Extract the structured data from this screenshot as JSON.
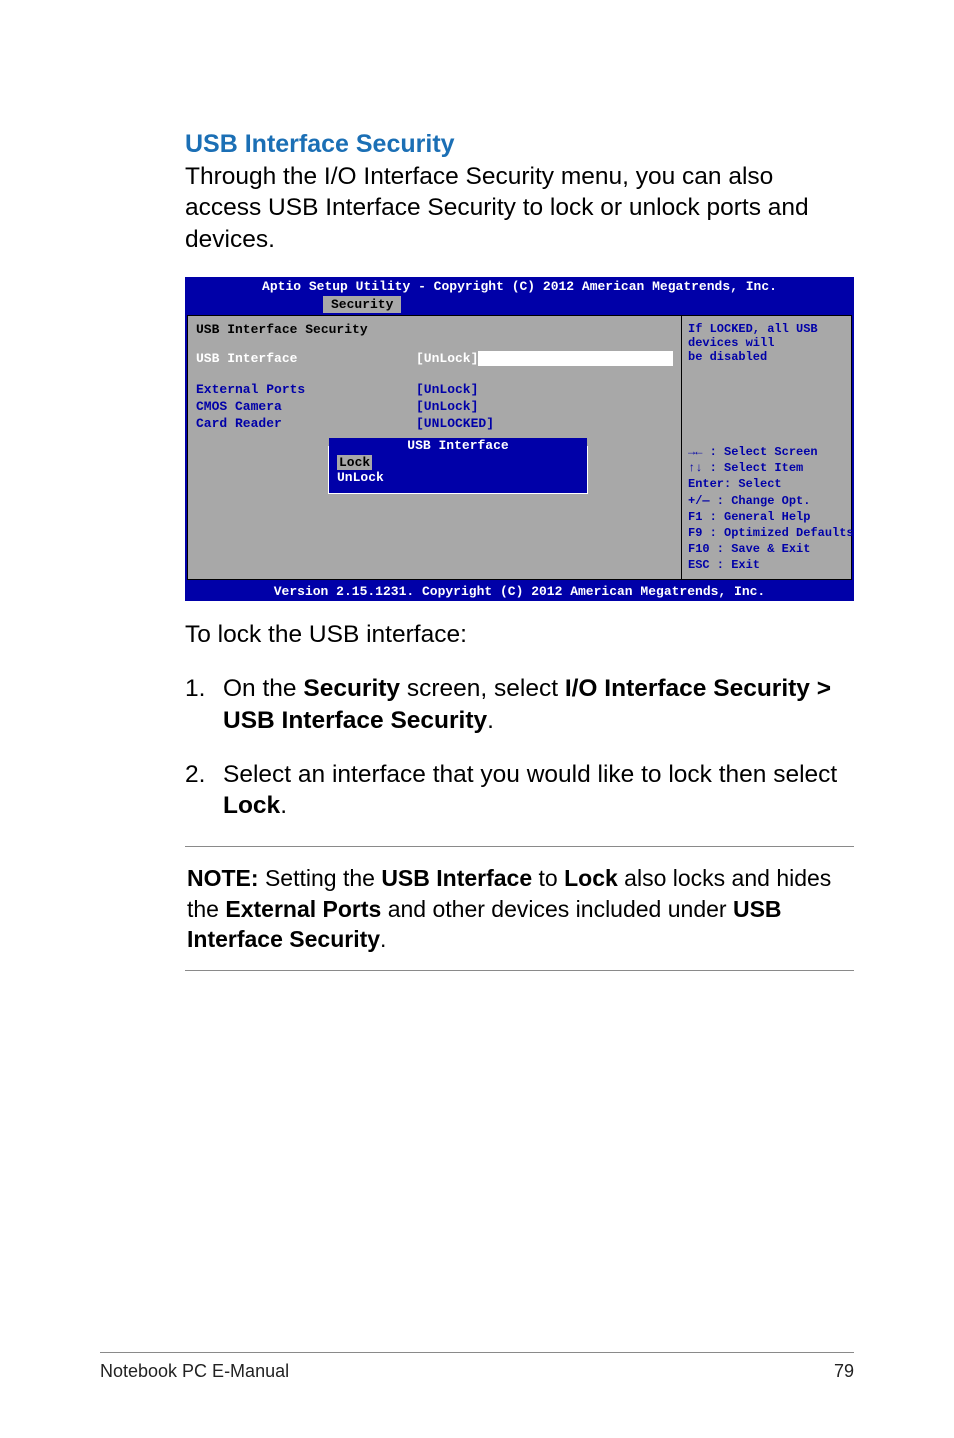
{
  "heading": "USB Interface Security",
  "intro": "Through the I/O Interface Security menu, you can also access USB Interface Security to lock or unlock ports and devices.",
  "bios": {
    "header": "Aptio Setup Utility - Copyright (C) 2012 American Megatrends, Inc.",
    "tab": "Security",
    "section_title": "USB Interface Security",
    "rows": {
      "usb_interface": {
        "label": "USB Interface",
        "value": "[UnLock]"
      },
      "external_ports": {
        "label": "External Ports",
        "value": "[UnLock]"
      },
      "cmos_camera": {
        "label": "CMOS Camera",
        "value": "[UnLock]"
      },
      "card_reader": {
        "label": "Card Reader",
        "value": "[UNLOCKED]"
      }
    },
    "popup": {
      "title": "USB Interface",
      "opt_lock": "Lock",
      "opt_unlock": "UnLock"
    },
    "help": {
      "line1": "If LOCKED, all USB",
      "line2": "devices will",
      "line3": "be disabled"
    },
    "nav": {
      "l1": "→←  : Select Screen",
      "l2": "↑↓  : Select Item",
      "l3": "Enter: Select",
      "l4": "+/—  : Change Opt.",
      "l5": "F1  : General Help",
      "l6": "F9  : Optimized Defaults",
      "l7": "F10 : Save & Exit",
      "l8": "ESC : Exit"
    },
    "footer": "Version 2.15.1231. Copyright (C) 2012 American Megatrends, Inc."
  },
  "after_img": "To lock the USB interface:",
  "steps": {
    "s1_num": "1.",
    "s1_a": "On the ",
    "s1_b": "Security",
    "s1_c": " screen, select ",
    "s1_d": "I/O Interface Security > USB Interface Security",
    "s1_e": ".",
    "s2_num": "2.",
    "s2_a": "Select an interface that you would like to lock then select ",
    "s2_b": "Lock",
    "s2_c": "."
  },
  "note": {
    "a": "NOTE:",
    "b": " Setting the ",
    "c": "USB Interface",
    "d": " to ",
    "e": "Lock",
    "f": " also locks and hides the ",
    "g": "External Ports",
    "h": " and other devices included under ",
    "i": "USB Interface Security",
    "j": "."
  },
  "footer": {
    "left": "Notebook PC E-Manual",
    "right": "79"
  }
}
